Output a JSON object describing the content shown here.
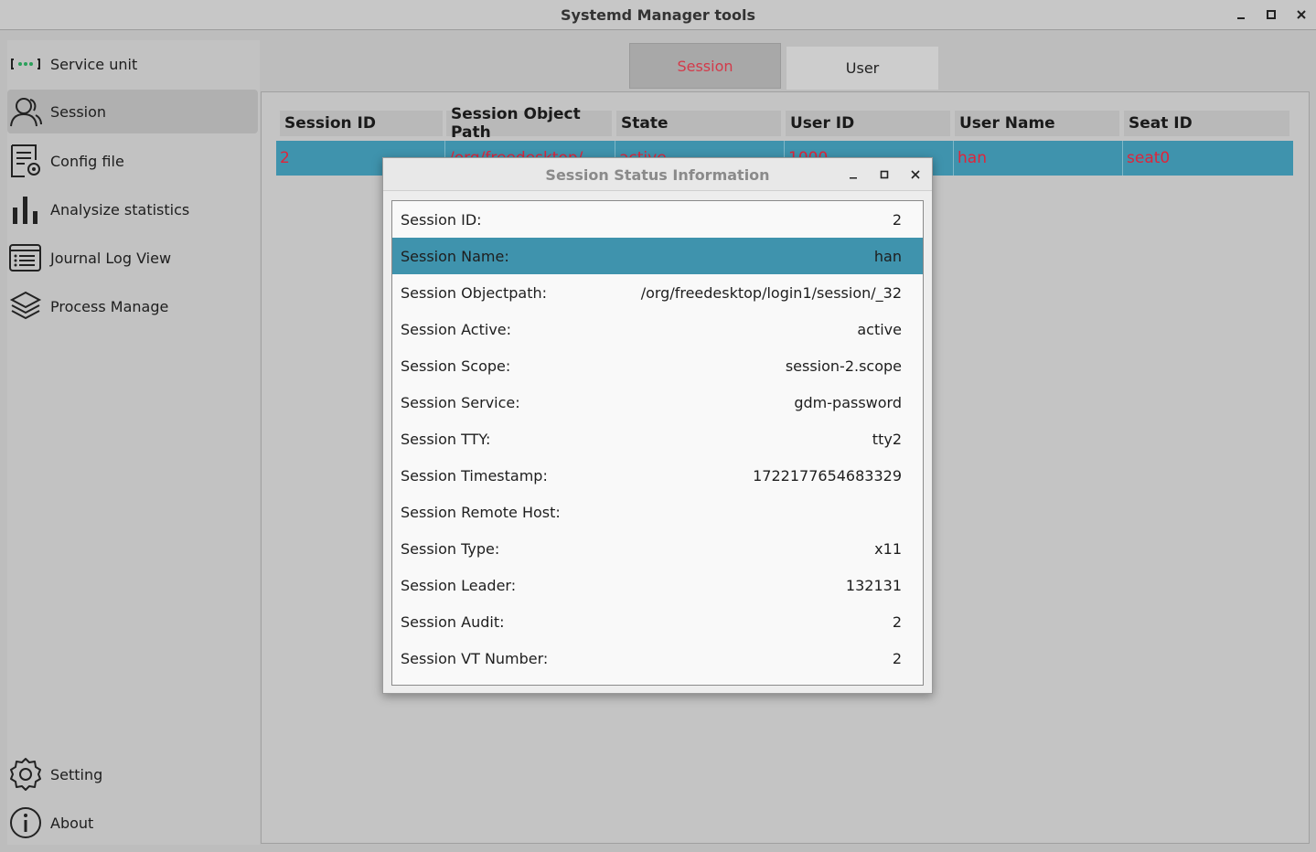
{
  "window": {
    "title": "Systemd Manager tools"
  },
  "sidebar": {
    "items": [
      {
        "label": "Service unit",
        "icon": "service-unit-icon"
      },
      {
        "label": "Session",
        "icon": "user-icon",
        "active": true
      },
      {
        "label": "Config file",
        "icon": "config-file-icon"
      },
      {
        "label": "Analysize statistics",
        "icon": "bar-chart-icon"
      },
      {
        "label": "Journal Log View",
        "icon": "journal-icon"
      },
      {
        "label": "Process Manage",
        "icon": "layers-icon"
      }
    ],
    "bottom": [
      {
        "label": "Setting",
        "icon": "gear-icon"
      },
      {
        "label": "About",
        "icon": "info-icon"
      }
    ]
  },
  "tabs": [
    {
      "label": "Session",
      "active": true
    },
    {
      "label": "User"
    }
  ],
  "table": {
    "headers": [
      "Session ID",
      "Session Object Path",
      "State",
      "User ID",
      "User Name",
      "Seat ID"
    ],
    "rows": [
      [
        "2",
        "/org/freedesktop/",
        "active",
        "1000",
        "han",
        "seat0"
      ]
    ]
  },
  "dialog": {
    "title": "Session Status Information",
    "rows": [
      {
        "label": "Session ID:",
        "value": "2"
      },
      {
        "label": "Session Name:",
        "value": "han",
        "selected": true
      },
      {
        "label": "Session Objectpath:",
        "value": "/org/freedesktop/login1/session/_32"
      },
      {
        "label": "Session Active:",
        "value": "active"
      },
      {
        "label": "Session Scope:",
        "value": "session-2.scope"
      },
      {
        "label": "Session Service:",
        "value": "gdm-password"
      },
      {
        "label": "Session TTY:",
        "value": "tty2"
      },
      {
        "label": "Session Timestamp:",
        "value": "1722177654683329"
      },
      {
        "label": "Session Remote Host:",
        "value": ""
      },
      {
        "label": "Session Type:",
        "value": "x11"
      },
      {
        "label": "Session Leader:",
        "value": "132131"
      },
      {
        "label": "Session Audit:",
        "value": "2"
      },
      {
        "label": "Session VT Number:",
        "value": "2"
      }
    ]
  },
  "colors": {
    "accent": "#3f93ad",
    "error_text": "#e0243a",
    "active_tab_text": "#d33a4a"
  }
}
